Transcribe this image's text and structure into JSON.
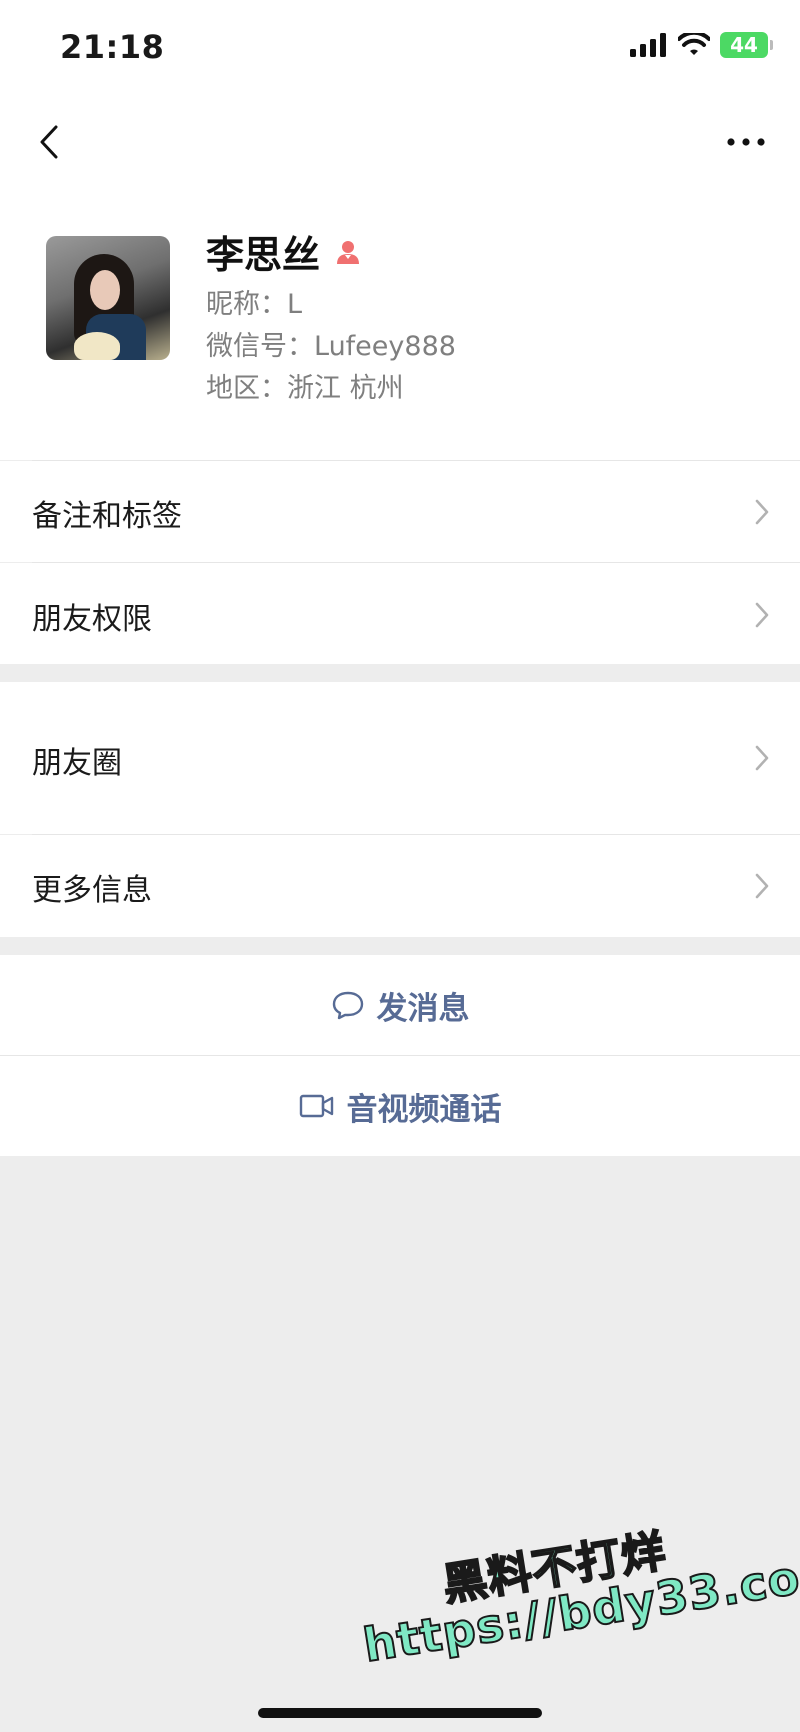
{
  "status_bar": {
    "time": "21:18",
    "battery": "44"
  },
  "nav": {
    "back_icon": "chevron-left-icon",
    "more_icon": "ellipsis-icon"
  },
  "profile": {
    "name": "李思丝",
    "gender_icon": "female-person-icon",
    "nickname": "昵称：L",
    "wechat_id": "微信号：Lufeey888",
    "region": "地区：浙江 杭州"
  },
  "menu": {
    "remarks_tags": "备注和标签",
    "friend_permissions": "朋友权限",
    "moments": "朋友圈",
    "more_info": "更多信息"
  },
  "actions": {
    "send_message": "发消息",
    "av_call": "音视频通话"
  },
  "watermark": {
    "line1": "黑料不打烊",
    "line2": "https://bdy33.co"
  },
  "colors": {
    "link_blue": "#576b95",
    "battery_green": "#4cd964",
    "female_icon": "#f07070",
    "watermark_green": "#7fe8c4"
  }
}
